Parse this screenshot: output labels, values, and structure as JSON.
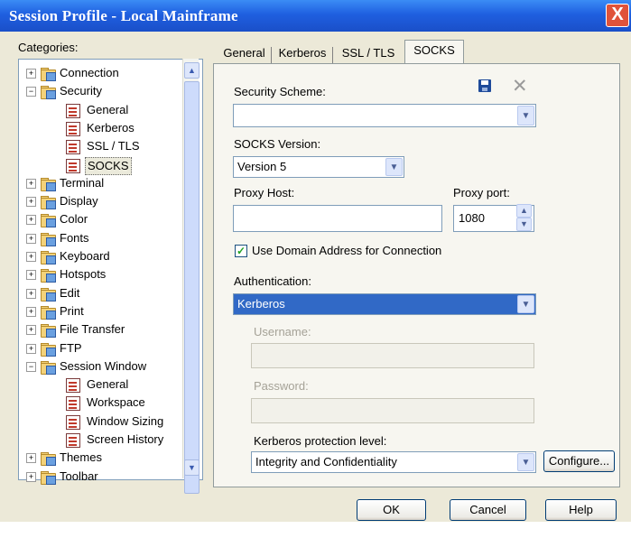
{
  "window": {
    "title": "Session Profile - Local Mainframe",
    "close": "X"
  },
  "categories": {
    "label": "Categories:",
    "items": [
      {
        "label": "Connection",
        "type": "folder",
        "expander": "+"
      },
      {
        "label": "Security",
        "type": "folder",
        "expander": "−"
      },
      {
        "label": "General",
        "type": "page"
      },
      {
        "label": "Kerberos",
        "type": "page"
      },
      {
        "label": "SSL / TLS",
        "type": "page"
      },
      {
        "label": "SOCKS",
        "type": "page",
        "selected": true
      },
      {
        "label": "Terminal",
        "type": "folder",
        "expander": "+"
      },
      {
        "label": "Display",
        "type": "folder",
        "expander": "+"
      },
      {
        "label": "Color",
        "type": "folder",
        "expander": "+"
      },
      {
        "label": "Fonts",
        "type": "folder",
        "expander": "+"
      },
      {
        "label": "Keyboard",
        "type": "folder",
        "expander": "+"
      },
      {
        "label": "Hotspots",
        "type": "folder",
        "expander": "+"
      },
      {
        "label": "Edit",
        "type": "folder",
        "expander": "+"
      },
      {
        "label": "Print",
        "type": "folder",
        "expander": "+"
      },
      {
        "label": "File Transfer",
        "type": "folder",
        "expander": "+"
      },
      {
        "label": "FTP",
        "type": "folder",
        "expander": "+"
      },
      {
        "label": "Session Window",
        "type": "folder",
        "expander": "−"
      },
      {
        "label": "General",
        "type": "page"
      },
      {
        "label": "Workspace",
        "type": "page"
      },
      {
        "label": "Window Sizing",
        "type": "page"
      },
      {
        "label": "Screen History",
        "type": "page"
      },
      {
        "label": "Themes",
        "type": "folder",
        "expander": "+"
      },
      {
        "label": "Toolbar",
        "type": "folder",
        "expander": "+"
      }
    ]
  },
  "tabs": [
    {
      "label": "General"
    },
    {
      "label": "Kerberos"
    },
    {
      "label": "SSL / TLS"
    },
    {
      "label": "SOCKS",
      "active": true
    }
  ],
  "socks": {
    "security_scheme_label": "Security Scheme:",
    "security_scheme_value": "",
    "socks_version_label": "SOCKS Version:",
    "socks_version_value": "Version 5",
    "proxy_host_label": "Proxy Host:",
    "proxy_host_value": "",
    "proxy_port_label": "Proxy port:",
    "proxy_port_value": "1080",
    "use_domain_label": "Use Domain Address for Connection",
    "use_domain_checked": true,
    "authentication_label": "Authentication:",
    "authentication_value": "Kerberos",
    "username_label": "Username:",
    "username_value": "",
    "password_label": "Password:",
    "password_value": "",
    "kerberos_level_label": "Kerberos protection level:",
    "kerberos_level_value": "Integrity and Confidentiality",
    "configure_label": "Configure..."
  },
  "buttons": {
    "ok": "OK",
    "cancel": "Cancel",
    "help": "Help"
  },
  "colors": {
    "titlebar": "#1f5fe0",
    "selection": "#3169c6",
    "dialog_bg": "#ece9d8"
  }
}
